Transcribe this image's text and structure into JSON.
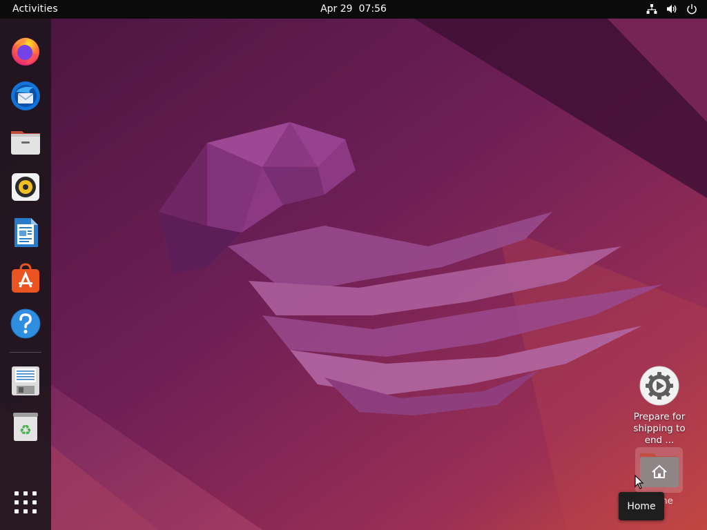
{
  "topbar": {
    "activities_label": "Activities",
    "date": "Apr 29",
    "time": "07:56",
    "tray_icons": [
      "network-icon",
      "volume-icon",
      "power-icon"
    ]
  },
  "dock": {
    "apps": [
      {
        "name": "firefox",
        "icon": "firefox-icon"
      },
      {
        "name": "thunderbird",
        "icon": "thunderbird-icon"
      },
      {
        "name": "files",
        "icon": "files-icon"
      },
      {
        "name": "rhythmbox",
        "icon": "rhythmbox-icon"
      },
      {
        "name": "libreoffice-writer",
        "icon": "writer-icon"
      },
      {
        "name": "ubuntu-software",
        "icon": "software-center-icon"
      },
      {
        "name": "help",
        "icon": "help-icon"
      },
      {
        "name": "disk-installer",
        "icon": "floppy-icon"
      },
      {
        "name": "trash",
        "icon": "trash-icon"
      },
      {
        "name": "show-applications",
        "icon": "app-grid-icon"
      }
    ]
  },
  "desktop": {
    "prepare_label": "Prepare for shipping to end ...",
    "home_label": "Home",
    "tooltip": "Home"
  },
  "colors": {
    "topbar": "#0b0b0b",
    "dock": "#1e161c",
    "wallpaper_base": "#5a1a48",
    "accent": "#e95420"
  }
}
